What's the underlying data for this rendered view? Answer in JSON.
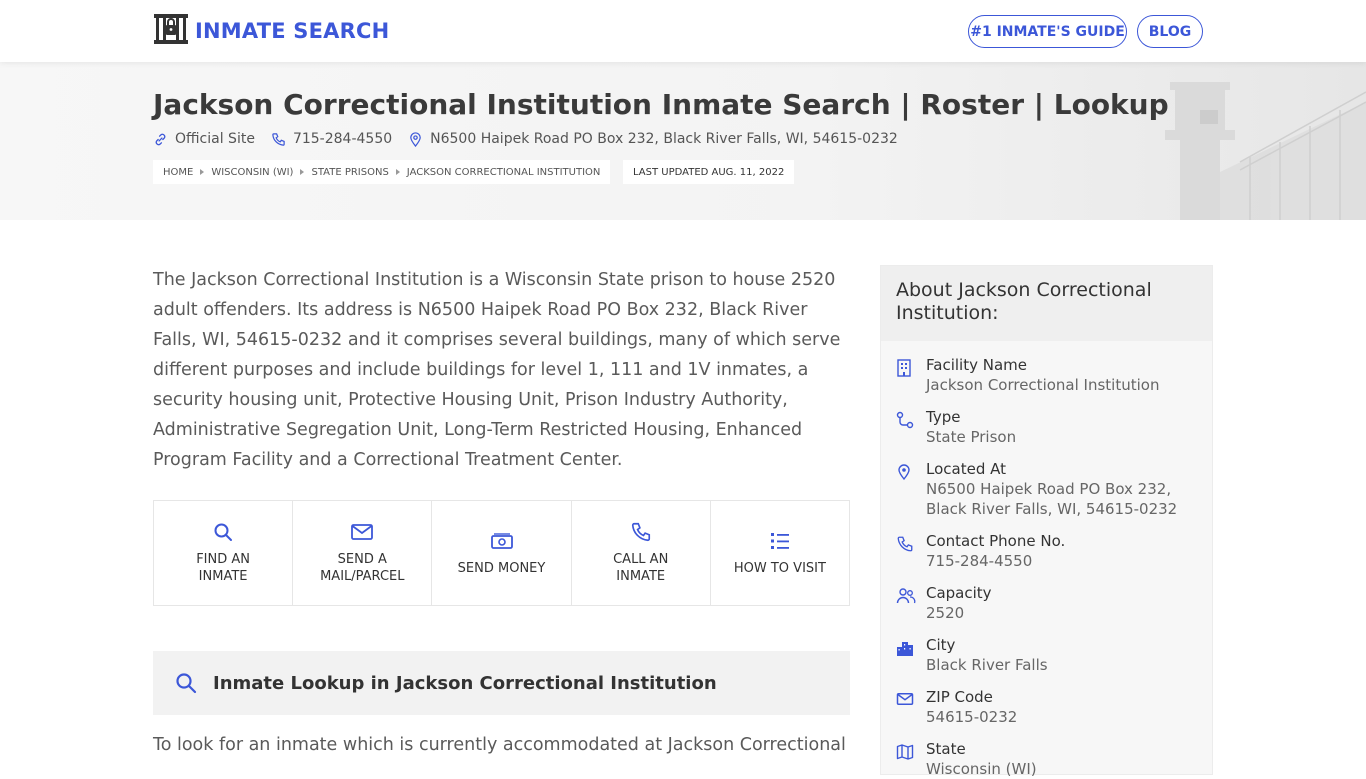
{
  "header": {
    "brand": "INMATE SEARCH",
    "nav": [
      {
        "label": "#1 INMATE'S GUIDE"
      },
      {
        "label": "BLOG"
      }
    ]
  },
  "hero": {
    "title": "Jackson Correctional Institution Inmate Search | Roster | Lookup",
    "official_site": "Official Site",
    "phone": "715-284-4550",
    "address": "N6500 Haipek Road PO Box 232, Black River Falls, WI, 54615-0232",
    "breadcrumbs": [
      "HOME",
      "WISCONSIN (WI)",
      "STATE PRISONS",
      "JACKSON CORRECTIONAL INSTITUTION"
    ],
    "last_updated": "LAST UPDATED AUG. 11, 2022"
  },
  "intro": "The Jackson Correctional Institution is a Wisconsin State prison to house 2520 adult offenders. Its address is N6500 Haipek Road PO Box 232, Black River Falls, WI, 54615-0232 and it comprises several buildings, many of which serve different purposes and include buildings for level 1, 111 and 1V inmates, a security housing unit, Protective Housing Unit, Prison Industry Authority, Administrative Segregation Unit, Long-Term Restricted Housing, Enhanced Program Facility and a Correctional Treatment Center.",
  "actions": [
    {
      "label": "FIND AN INMATE",
      "icon": "search-icon"
    },
    {
      "label": "SEND A MAIL/PARCEL",
      "icon": "mail-icon"
    },
    {
      "label": "SEND MONEY",
      "icon": "money-icon"
    },
    {
      "label": "CALL AN INMATE",
      "icon": "phone-icon"
    },
    {
      "label": "HOW TO VISIT",
      "icon": "list-icon"
    }
  ],
  "lookup": {
    "title": "Inmate Lookup in Jackson Correctional Institution"
  },
  "tail_text": "To look for an inmate which is currently accommodated at Jackson Correctional",
  "sidebar": {
    "title": "About Jackson Correctional Institution:",
    "items": [
      {
        "label": "Facility Name",
        "value": "Jackson Correctional Institution",
        "icon": "building-icon"
      },
      {
        "label": "Type",
        "value": "State Prison",
        "icon": "route-icon"
      },
      {
        "label": "Located At",
        "value": "N6500 Haipek Road PO Box 232, Black River Falls, WI, 54615-0232",
        "icon": "location-pin-icon"
      },
      {
        "label": "Contact Phone No.",
        "value": "715-284-4550",
        "icon": "phone-icon"
      },
      {
        "label": "Capacity",
        "value": "2520",
        "icon": "users-icon"
      },
      {
        "label": "City",
        "value": "Black River Falls",
        "icon": "city-icon"
      },
      {
        "label": "ZIP Code",
        "value": "54615-0232",
        "icon": "mail-icon"
      },
      {
        "label": "State",
        "value": "Wisconsin (WI)",
        "icon": "map-icon"
      }
    ]
  },
  "colors": {
    "accent": "#3c57d8",
    "text": "#3a3a3a",
    "muted": "#5a5a5a"
  }
}
